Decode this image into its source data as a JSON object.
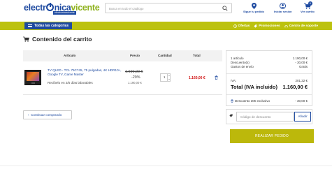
{
  "logo": {
    "text_before": "electr",
    "text_mid": "nica",
    "text_after": "vicente",
    "subtitle": "electronicavicente"
  },
  "search": {
    "placeholder": "Busca en todo el catálogo"
  },
  "header_links": {
    "track": "Sigue tu pedido",
    "login": "Iniciar sesión",
    "cart": "Ver carrito",
    "cart_count": "1"
  },
  "nav": {
    "categories": "Todas las categorías",
    "offers": "Ofertas",
    "promotions": "Promociones",
    "support": "Centro de soporte"
  },
  "page": {
    "title": "Contenido del carrito"
  },
  "table": {
    "headers": {
      "article": "Artículo",
      "price": "Precio",
      "qty": "Cantidad",
      "total": "Total"
    },
    "row": {
      "name": "TV QLED - TCL 75C745, 75 pulgadas, 4K HDR10+, Google TV, Game Master",
      "stock": "Recíbelo en 2/5 días laborables",
      "price_old": "1.690,00 €",
      "discount": "-29%",
      "price_new": "1.190,00 €",
      "quantity": "1",
      "total": "1.160,00 €"
    }
  },
  "continue_label": "Continuar comprando",
  "summary": {
    "items_label": "1 artículo",
    "items_value": "1.190,00 €",
    "discount_label": "Descuento(s)",
    "discount_value": "- 30,00 €",
    "shipping_label": "Gastos de envío",
    "shipping_value": "Gratis",
    "iva_label": "IVA:",
    "iva_value": "201,32 €",
    "total_label": "Total (IVA incluido)",
    "total_value": "1.160,00 €",
    "coupon_applied_label": "Descuento 30€ exclusivo",
    "coupon_applied_value": "- 30,00 €"
  },
  "coupon": {
    "placeholder": "Código de descuento",
    "apply": "Añadir"
  },
  "checkout_label": "REALIZAR PEDIDO",
  "colors": {
    "brand_blue": "#1e4aa0",
    "brand_green": "#8fb21e",
    "navbar": "#bcc20f",
    "checkout": "#bcb80b",
    "price_red": "#d01010"
  }
}
